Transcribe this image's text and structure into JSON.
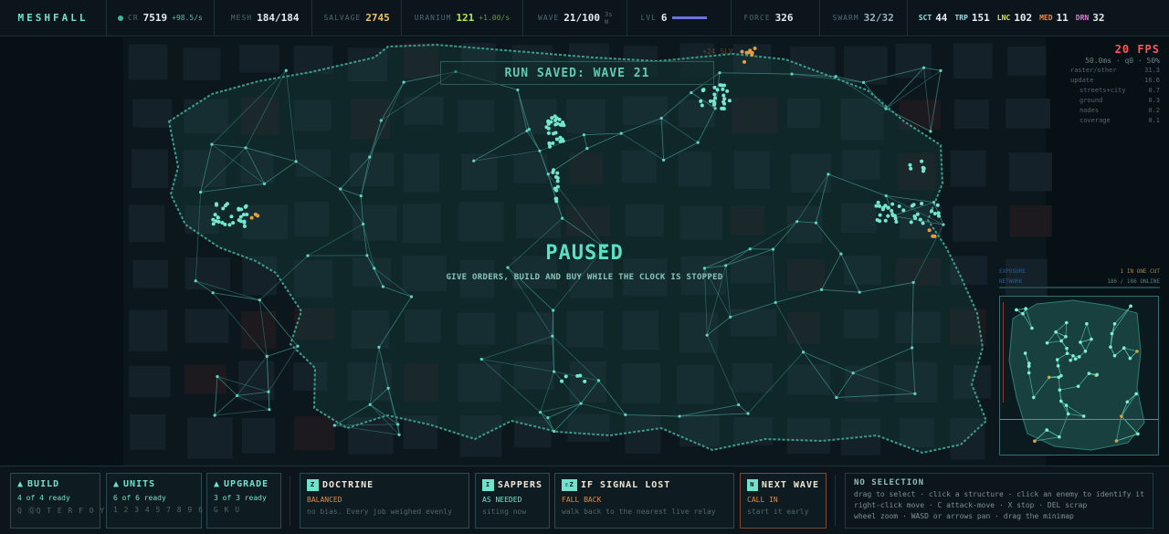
{
  "topbar": {
    "logo": "MESHFALL",
    "cr": {
      "label": "CR",
      "value": "7519",
      "rate": "+98.5/s"
    },
    "mesh": {
      "label": "MESH",
      "value": "184/184"
    },
    "salvage": {
      "label": "SALVAGE",
      "value": "2745"
    },
    "uranium": {
      "label": "URANIUM",
      "value": "121",
      "rate": "+1.00/s"
    },
    "wave": {
      "label": "WAVE",
      "value": "21/100",
      "sub_top": "3s",
      "sub_bottom": "W"
    },
    "lvl": {
      "label": "LVL",
      "value": "6",
      "progress": 1.0
    },
    "force": {
      "label": "FORCE",
      "value": "326"
    },
    "swarm": {
      "label": "SWARM",
      "value": "32/32"
    },
    "units": [
      {
        "label": "SCT",
        "value": "44",
        "color": "#8fe0f0"
      },
      {
        "label": "TRP",
        "value": "151",
        "color": "#8fe0f0"
      },
      {
        "label": "LNC",
        "value": "102",
        "color": "#d6e94a"
      },
      {
        "label": "MED",
        "value": "11",
        "color": "#f08a3a"
      },
      {
        "label": "DRN",
        "value": "32",
        "color": "#e07ad8"
      }
    ]
  },
  "map": {
    "banner": "RUN SAVED: WAVE 21",
    "paused_title": "PAUSED",
    "paused_subtitle": "GIVE ORDERS, BUILD AND BUY WHILE THE CLOCK IS STOPPED",
    "float_text": "+24 SLV",
    "perf": {
      "fps": "20 FPS",
      "summary": "50.0ms · q0 · 50%",
      "rows": [
        {
          "name": "raster/other",
          "value": "31.3"
        },
        {
          "name": "update",
          "value": "16.6"
        },
        {
          "name": "streets+city",
          "value": "0.7"
        },
        {
          "name": "ground",
          "value": "0.3"
        },
        {
          "name": "nodes",
          "value": "0.2"
        },
        {
          "name": "coverage",
          "value": "0.1"
        }
      ]
    },
    "minimap": {
      "exposure_label": "EXPOSURE",
      "exposure_value": "1 IN ONE CUT",
      "network_label": "NETWORK",
      "network_value": "186 / 186 ONLINE"
    }
  },
  "bottom": {
    "build": {
      "title": "BUILD",
      "status": "4 of 4 ready",
      "keys": "Q ⓆQ T E R F O Y"
    },
    "units": {
      "title": "UNITS",
      "status": "6 of 6 ready",
      "keys": "1 2 3 4 5 7 8 9 6"
    },
    "upgrade": {
      "title": "UPGRADE",
      "status": "3 of 3 ready",
      "keys": "G K U"
    },
    "doctrine": {
      "key": "Z",
      "title": "DOCTRINE",
      "mode": "BALANCED",
      "desc": "no bias. Every job weighed evenly"
    },
    "sappers": {
      "key": "I",
      "title": "SAPPERS",
      "mode": "AS NEEDED",
      "desc": "siting now"
    },
    "signal": {
      "key": "⇧Z",
      "title": "IF SIGNAL LOST",
      "mode": "FALL BACK",
      "desc": "walk back to the nearest live relay"
    },
    "nextwave": {
      "key": "N",
      "title": "NEXT WAVE",
      "mode": "CALL IN",
      "desc": "start it early"
    },
    "help": {
      "title": "NO SELECTION",
      "lines": [
        "drag to select · click a structure · click an enemy to identify it",
        "right-click move · C attack-move · X stop · DEL scrap",
        "wheel zoom · WASD or arrows pan · drag the minimap"
      ]
    },
    "arrow_glyph": "▲"
  }
}
